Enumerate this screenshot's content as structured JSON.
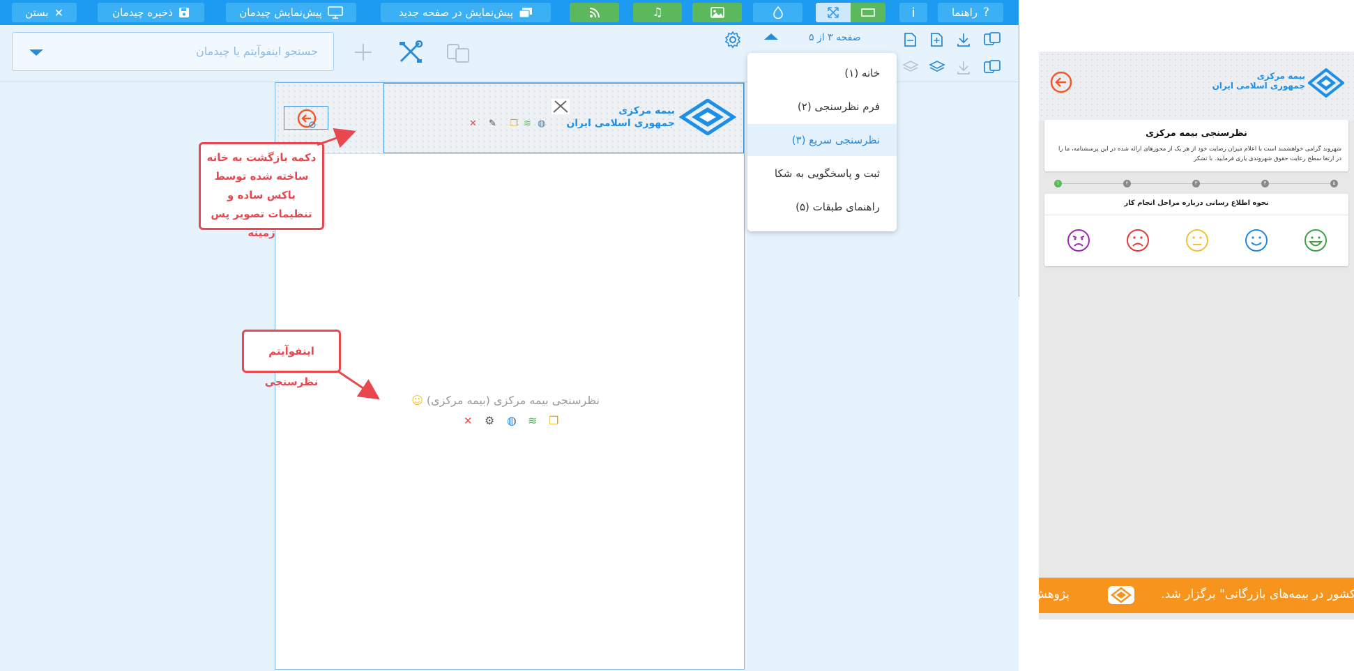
{
  "toolbar": {
    "close_label": "بستن",
    "save_label": "ذخیره چیدمان",
    "preview_label": "پیش‌نمایش چیدمان",
    "preview_new_page_label": "پیش‌نمایش در صفحه جدید",
    "help_label": "راهنما",
    "info_label": "i"
  },
  "subbar": {
    "search_placeholder": "جستجو اینفوآیتم یا چیدمان",
    "page_indicator": "صفحه ۳ از ۵"
  },
  "pages_menu": {
    "items": [
      {
        "label": "خانه (۱)"
      },
      {
        "label": "فرم نظرسنجی (۲)"
      },
      {
        "label": "نظرسنجی سریع (۳)"
      },
      {
        "label": "ثبت و پاسخگویی به شکا"
      },
      {
        "label": "راهنمای طبقات (۵)"
      }
    ],
    "active_index": 2
  },
  "canvas": {
    "header_logo_line1": "بیمه مرکزی",
    "header_logo_line2": "جمهوری اسلامی ایران",
    "survey_item_label": "نظرسنجی بیمه مرکزی (بیمه مرکزی)"
  },
  "annotations": {
    "back_button_note": "دکمه بازگشت به خانه ساخته شده توسط باکس ساده و تنظیمات تصویر پس زمینه",
    "survey_note": "اینفوآیتم نظرسنجی"
  },
  "preview": {
    "logo_line1": "بیمه مرکزی",
    "logo_line2": "جمهوری اسلامی ایران",
    "survey_title": "نظرسنجی بیمه مرکزی",
    "survey_desc": "شهروند گرامی خواهشمند است با اعلام میزان رضایت خود از هر یک از محورهای ارائه شده در این پرسشنامه، ما را در ارتقا سطح رعایت حقوق شهروندی یاری فرمایید. با تشکر",
    "steps": [
      "۱",
      "۲",
      "۳",
      "۴",
      "۵"
    ],
    "question_title": "نحوه اطلاع رسانی درباره مراحل انجام کار",
    "ticker_text": "کشور در بیمه‌های بازرگانی\" برگزار شد.",
    "ticker_next": "پژوهش"
  },
  "colors": {
    "toolbar_blue": "#1d9bf0",
    "green": "#5cb85c",
    "annotation_red": "#e8474f",
    "ticker_orange": "#f7941d"
  }
}
